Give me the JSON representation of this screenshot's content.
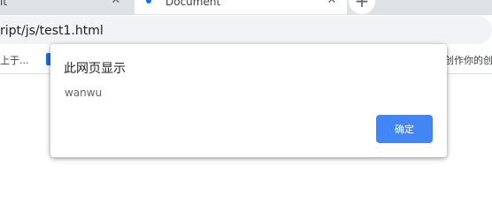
{
  "browser": {
    "tabs": [
      {
        "title": "it",
        "close_glyph": "✕"
      },
      {
        "title": "Document",
        "close_glyph": "✕"
      }
    ],
    "new_tab_glyph": "+",
    "address_bar": {
      "url": "ript/js/test1.html"
    },
    "bookmarks": [
      {
        "label": "上于..."
      },
      {
        "label": "创作你的创"
      }
    ]
  },
  "dialog": {
    "title": "此网页显示",
    "message": "wanwu",
    "ok_label": "确定"
  },
  "colors": {
    "tabstrip": "#dee1e6",
    "omnibox": "#f1f3f4",
    "ok_button": "#4285f4",
    "favicon": "#1a73e8"
  },
  "icons": {
    "favicon": "page-favicon-icon",
    "tab_close": "close-icon",
    "new_tab": "plus-icon",
    "bookmark": "bookmark-favicon-icon"
  }
}
